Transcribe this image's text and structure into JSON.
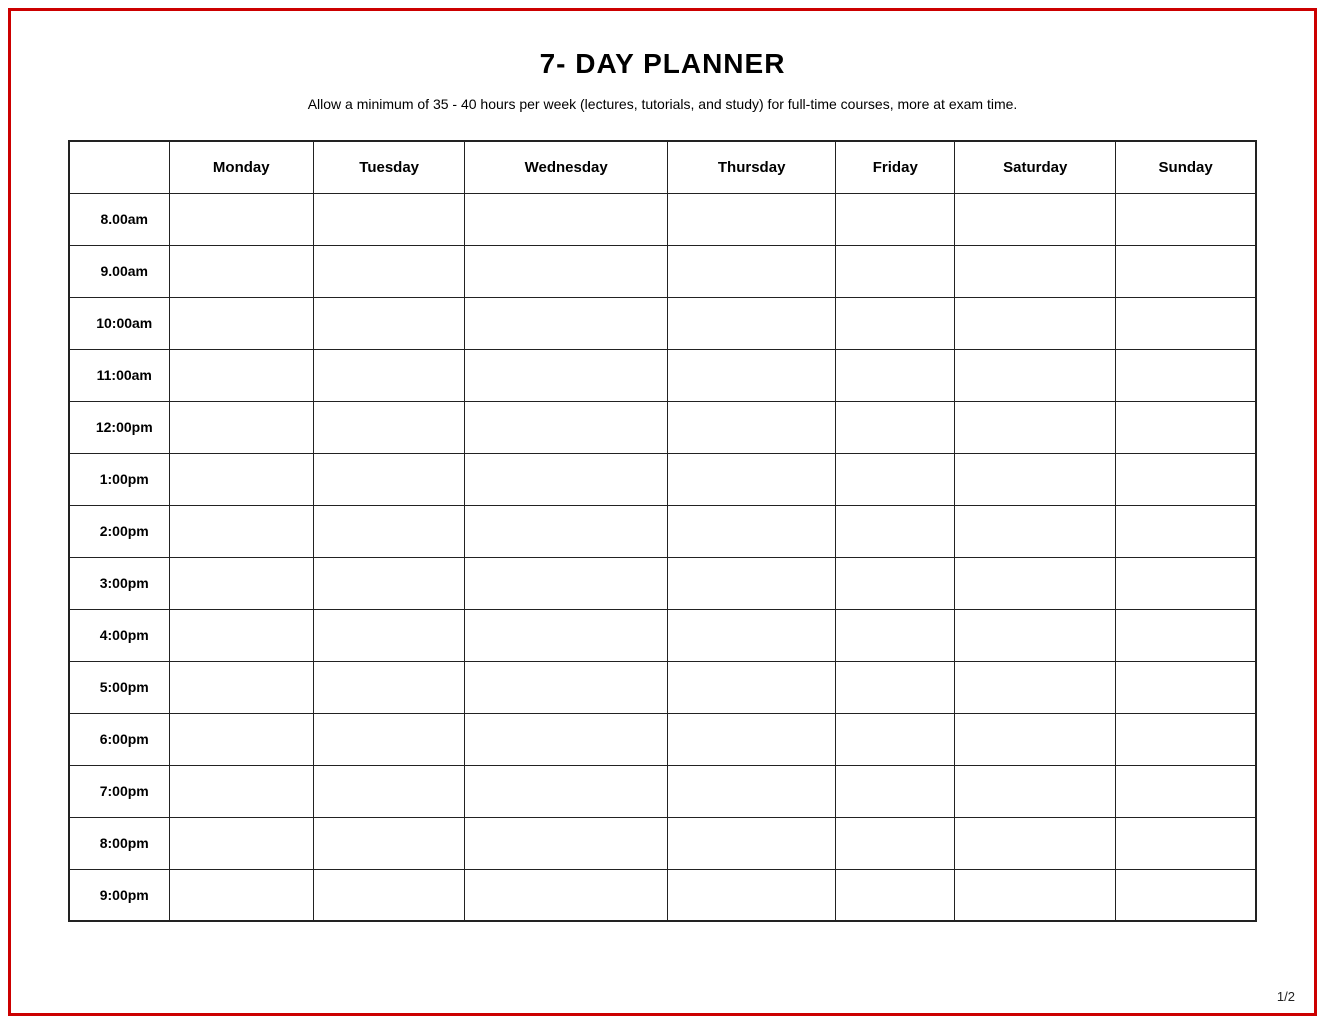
{
  "page": {
    "title": "7- DAY PLANNER",
    "subtitle": "Allow a minimum of 35 - 40 hours per week (lectures, tutorials, and study) for full-time courses, more at exam time.",
    "page_number": "1/2"
  },
  "table": {
    "headers": {
      "time_col": "",
      "days": [
        "Monday",
        "Tuesday",
        "Wednesday",
        "Thursday",
        "Friday",
        "Saturday",
        "Sunday"
      ]
    },
    "time_slots": [
      "8.00am",
      "9.00am",
      "10:00am",
      "11:00am",
      "12:00pm",
      "1:00pm",
      "2:00pm",
      "3:00pm",
      "4:00pm",
      "5:00pm",
      "6:00pm",
      "7:00pm",
      "8:00pm",
      "9:00pm"
    ]
  }
}
